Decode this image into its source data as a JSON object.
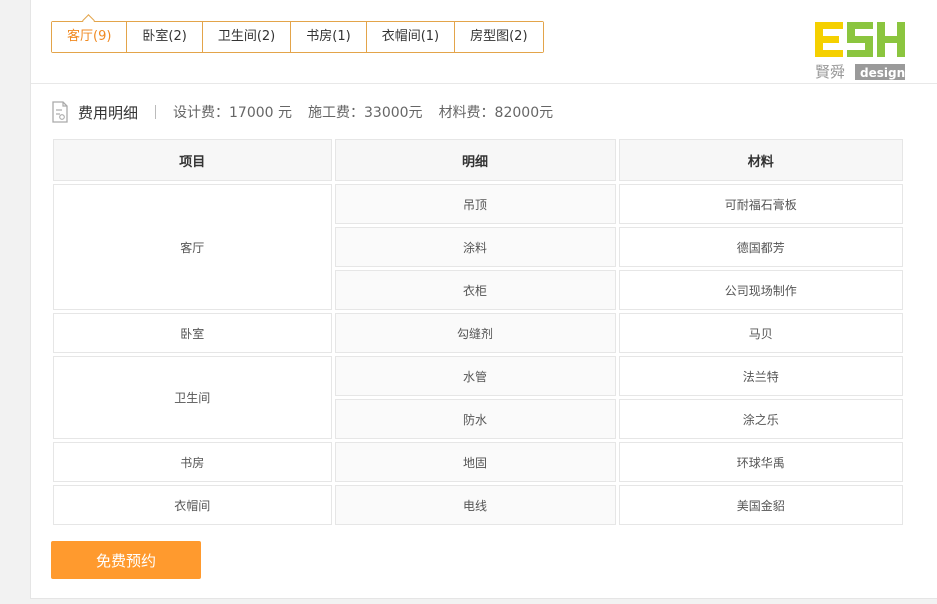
{
  "tabs": [
    {
      "label": "客厅(9)",
      "active": true
    },
    {
      "label": "卧室(2)",
      "active": false
    },
    {
      "label": "卫生间(2)",
      "active": false
    },
    {
      "label": "书房(1)",
      "active": false
    },
    {
      "label": "衣帽间(1)",
      "active": false
    },
    {
      "label": "房型图(2)",
      "active": false
    }
  ],
  "logo": {
    "letters": "ESH",
    "sub_cn": "賢舜",
    "sub_en": "design",
    "colors": {
      "e": "#f5d000",
      "s": "#8bc53f",
      "h": "#8bc53f",
      "sub": "#999999"
    }
  },
  "cost": {
    "title": "费用明细",
    "icon": "receipt-icon",
    "design_fee": "设计费：17000 元",
    "construction_fee": "施工费：33000元",
    "material_fee": "材料费：82000元"
  },
  "table": {
    "headers": [
      "项目",
      "明细",
      "材料"
    ],
    "groups": [
      {
        "item": "客厅",
        "rows": [
          {
            "detail": "吊顶",
            "material": "可耐福石膏板"
          },
          {
            "detail": "涂料",
            "material": "德国都芳"
          },
          {
            "detail": "衣柜",
            "material": "公司现场制作"
          }
        ]
      },
      {
        "item": "卧室",
        "rows": [
          {
            "detail": "勾缝剂",
            "material": "马贝"
          }
        ]
      },
      {
        "item": "卫生间",
        "rows": [
          {
            "detail": "水管",
            "material": "法兰特"
          },
          {
            "detail": "防水",
            "material": "涂之乐"
          }
        ]
      },
      {
        "item": "书房",
        "rows": [
          {
            "detail": "地固",
            "material": "环球华禹"
          }
        ]
      },
      {
        "item": "衣帽间",
        "rows": [
          {
            "detail": "电线",
            "material": "美国金貂"
          }
        ]
      }
    ]
  },
  "book_button": {
    "label": "免费预约",
    "color": "#ff9a2e"
  },
  "accent_color": "#f08a22"
}
